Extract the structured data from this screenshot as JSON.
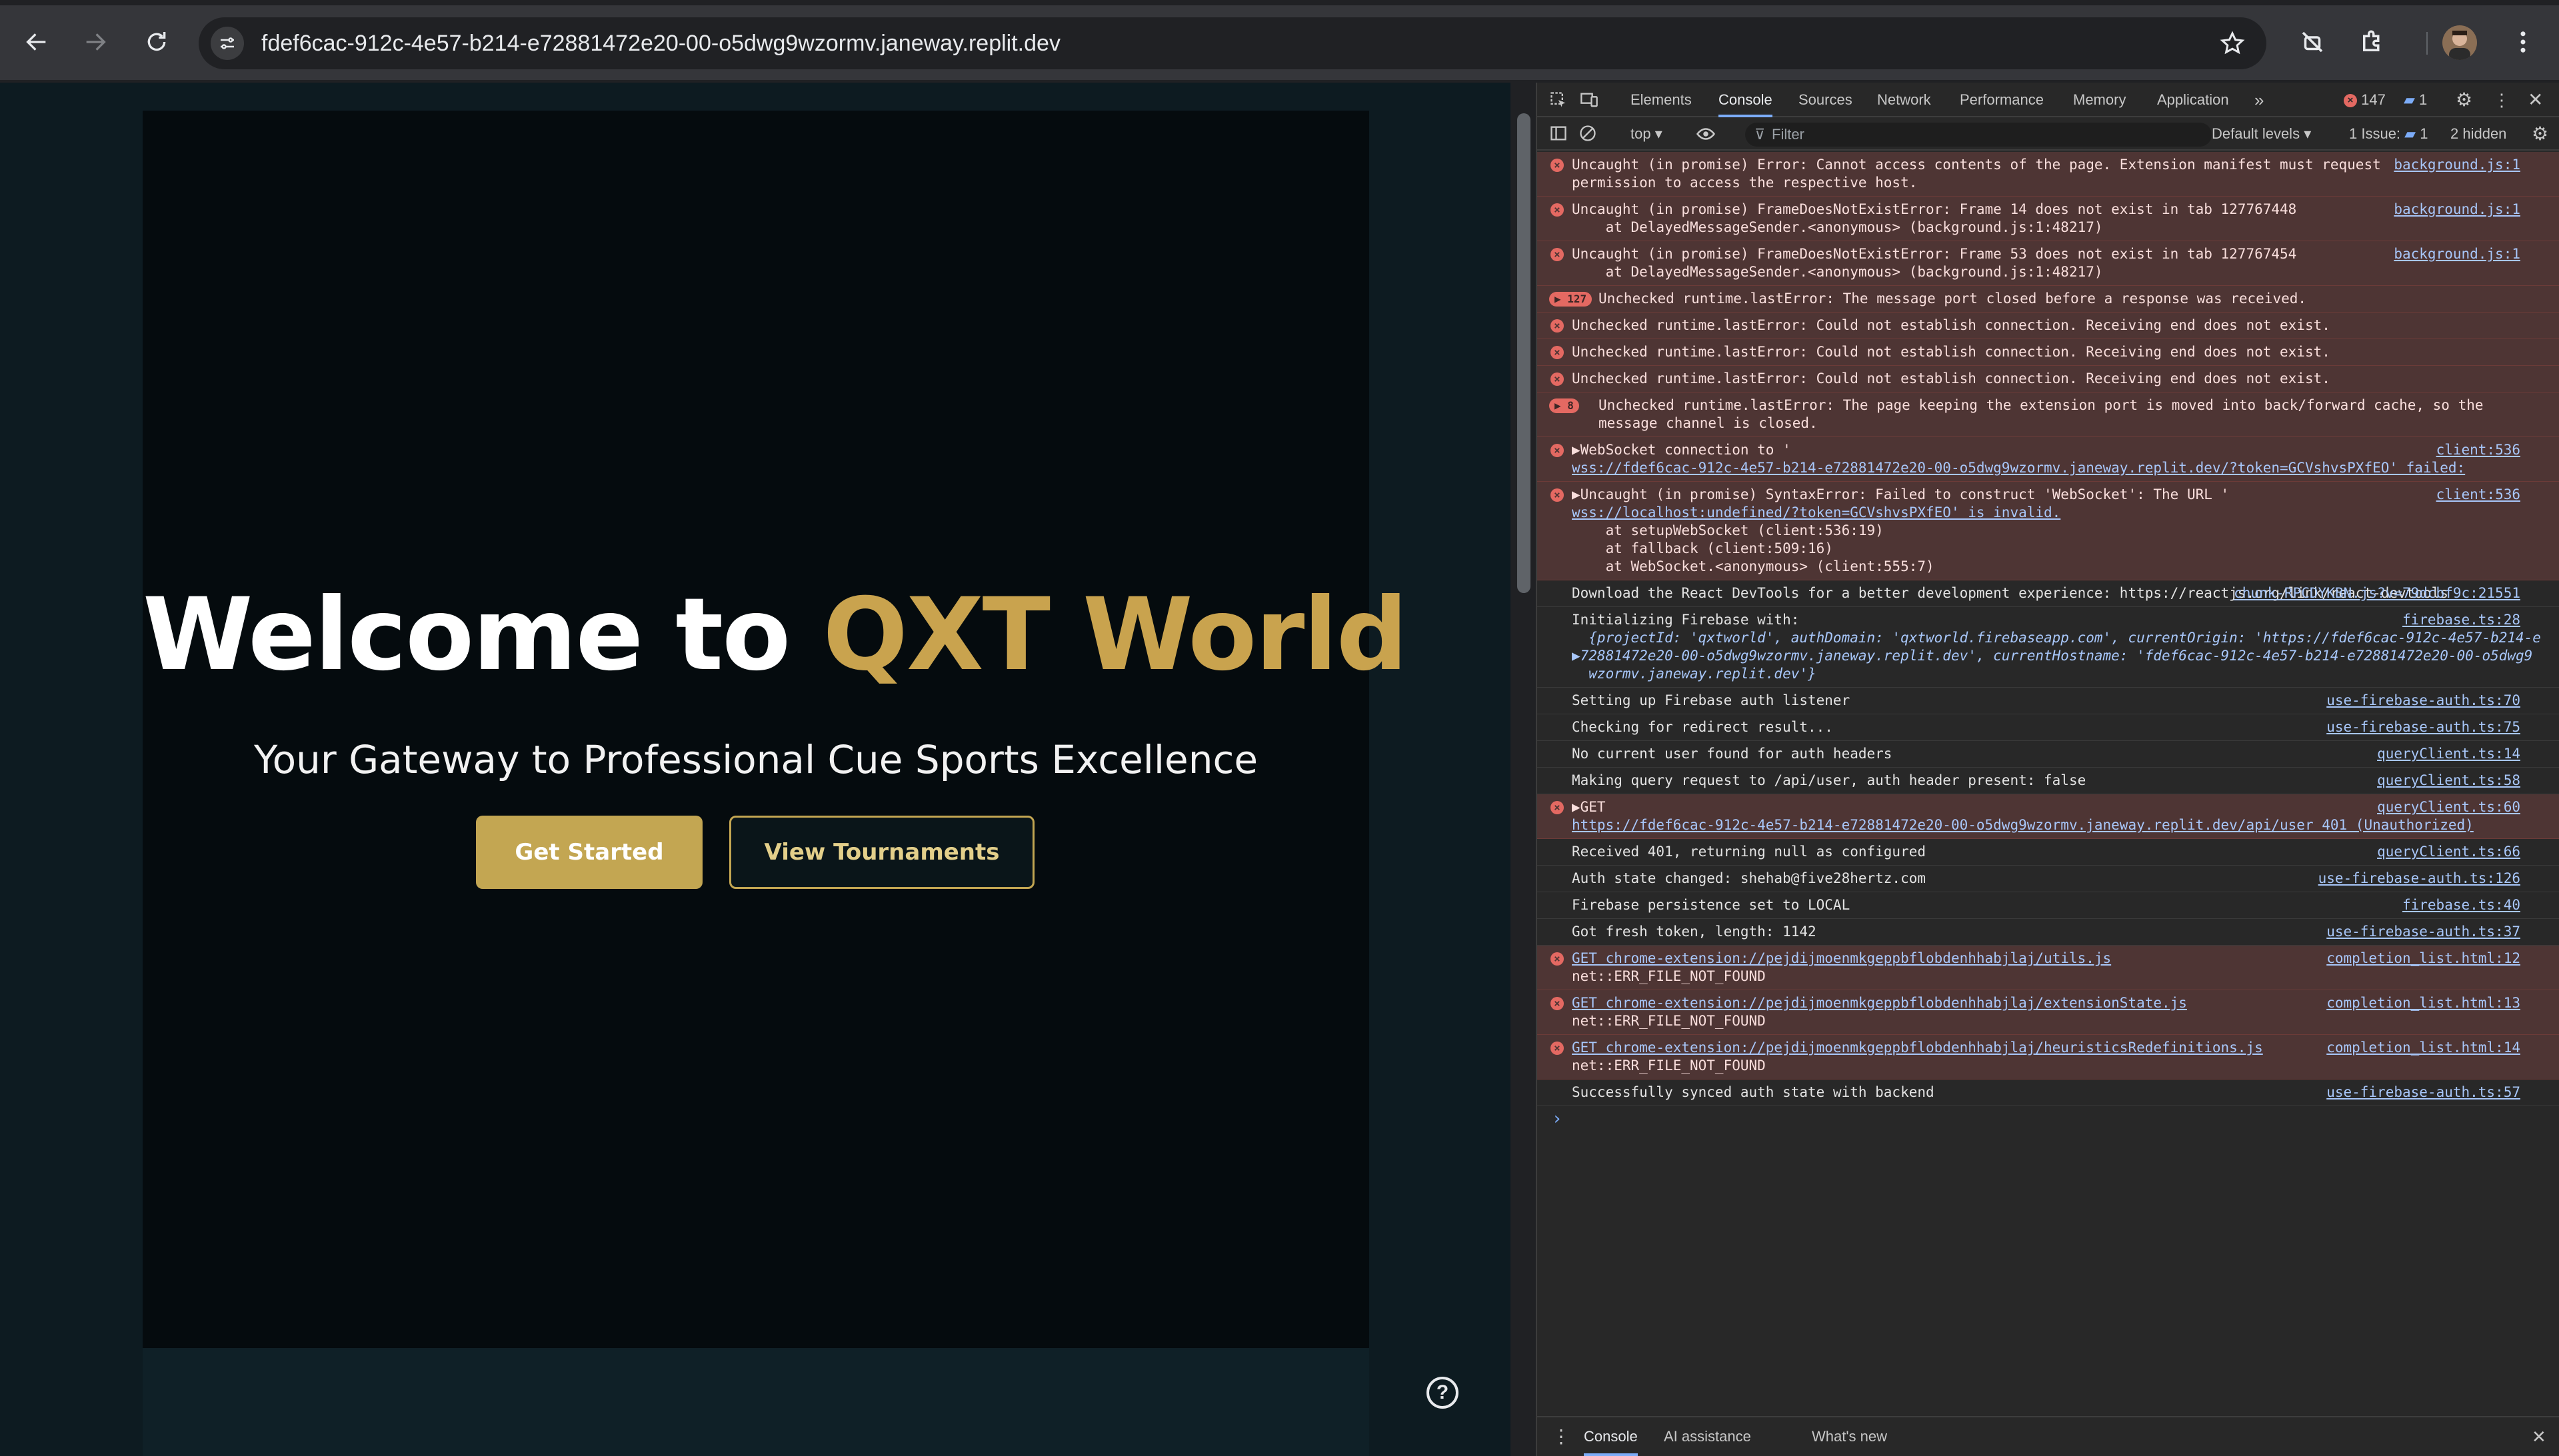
{
  "browser": {
    "url": "fdef6cac-912c-4e57-b214-e72881472e20-00-o5dwg9wzormv.janeway.replit.dev"
  },
  "page": {
    "title_main": "Welcome to ",
    "title_accent": "QXT World",
    "subtitle": "Your Gateway to Professional Cue Sports Excellence",
    "primary_button": "Get Started",
    "secondary_button": "View Tournaments",
    "help_glyph": "?",
    "colors": {
      "accent": "#c9a34e",
      "background": "#050b0e"
    }
  },
  "devtools": {
    "tabs": [
      "Elements",
      "Console",
      "Sources",
      "Network",
      "Performance",
      "Memory",
      "Application"
    ],
    "active_tab": "Console",
    "error_count": "147",
    "message_count": "1",
    "context": "top",
    "filter_placeholder": "Filter",
    "levels": "Default levels",
    "issues_label": "1 Issue:",
    "issues_count": "1",
    "hidden": "2 hidden",
    "drawer_tabs": [
      "Console",
      "AI assistance",
      "What's new"
    ],
    "messages": [
      {
        "type": "error",
        "lines": [
          "Uncaught (in promise) Error: Cannot access contents of the page. Extension manifest must request",
          "permission to access the respective host."
        ],
        "source": "background.js:1"
      },
      {
        "type": "error",
        "lines": [
          "Uncaught (in promise) FrameDoesNotExistError: Frame 14 does not exist in tab 127767448",
          "    at DelayedMessageSender.<anonymous> (background.js:1:48217)"
        ],
        "source": "background.js:1"
      },
      {
        "type": "error",
        "lines": [
          "Uncaught (in promise) FrameDoesNotExistError: Frame 53 does not exist in tab 127767454",
          "    at DelayedMessageSender.<anonymous> (background.js:1:48217)"
        ],
        "source": "background.js:1"
      },
      {
        "type": "error",
        "count": "127",
        "lines": [
          "Unchecked runtime.lastError: The message port closed before a response was received."
        ],
        "source": ""
      },
      {
        "type": "error",
        "lines": [
          "Unchecked runtime.lastError: Could not establish connection. Receiving end does not exist."
        ],
        "source": ""
      },
      {
        "type": "error",
        "lines": [
          "Unchecked runtime.lastError: Could not establish connection. Receiving end does not exist."
        ],
        "source": ""
      },
      {
        "type": "error",
        "lines": [
          "Unchecked runtime.lastError: Could not establish connection. Receiving end does not exist."
        ],
        "source": ""
      },
      {
        "type": "error",
        "count": "8",
        "lines": [
          "Unchecked runtime.lastError: The page keeping the extension port is moved into back/forward cache, so the",
          "message channel is closed."
        ],
        "source": ""
      },
      {
        "type": "error",
        "lines": [
          "▶WebSocket connection to '",
          "wss://fdef6cac-912c-4e57-b214-e72881472e20-00-o5dwg9wzormv.janeway.replit.dev/?token=GCVshvsPXfEO' failed:"
        ],
        "source": "client:536"
      },
      {
        "type": "error",
        "lines": [
          "▶Uncaught (in promise) SyntaxError: Failed to construct 'WebSocket': The URL '",
          "wss://localhost:undefined/?token=GCVshvsPXfEO' is invalid.",
          "    at setupWebSocket (client:536:19)",
          "    at fallback (client:509:16)",
          "    at WebSocket.<anonymous> (client:555:7)"
        ],
        "source": "client:536"
      },
      {
        "type": "log",
        "lines": [
          "",
          "Download the React DevTools for a better development experience: https://reactjs.org/link/react-devtools"
        ],
        "source": "chunk-RPCDYKBN.js?v=79dcbf9c:21551"
      },
      {
        "type": "log",
        "lines": [
          "Initializing Firebase with:",
          "  {projectId: 'qxtworld', authDomain: 'qxtworld.firebaseapp.com', currentOrigin: 'https://fdef6cac-912c-4e57-b214-e",
          "▶72881472e20-00-o5dwg9wzormv.janeway.replit.dev', currentHostname: 'fdef6cac-912c-4e57-b214-e72881472e20-00-o5dwg9",
          "  wzormv.janeway.replit.dev'}"
        ],
        "source": "firebase.ts:28"
      },
      {
        "type": "log",
        "lines": [
          "Setting up Firebase auth listener"
        ],
        "source": "use-firebase-auth.ts:70"
      },
      {
        "type": "log",
        "lines": [
          "Checking for redirect result..."
        ],
        "source": "use-firebase-auth.ts:75"
      },
      {
        "type": "log",
        "lines": [
          "No current user found for auth headers"
        ],
        "source": "queryClient.ts:14"
      },
      {
        "type": "log",
        "lines": [
          "Making query request to /api/user, auth header present: false"
        ],
        "source": "queryClient.ts:58"
      },
      {
        "type": "error",
        "lines": [
          "▶GET",
          "https://fdef6cac-912c-4e57-b214-e72881472e20-00-o5dwg9wzormv.janeway.replit.dev/api/user 401 (Unauthorized)"
        ],
        "source": "queryClient.ts:60"
      },
      {
        "type": "log",
        "lines": [
          "Received 401, returning null as configured"
        ],
        "source": "queryClient.ts:66"
      },
      {
        "type": "log",
        "lines": [
          "Auth state changed: shehab@five28hertz.com"
        ],
        "source": "use-firebase-auth.ts:126"
      },
      {
        "type": "log",
        "lines": [
          "Firebase persistence set to LOCAL"
        ],
        "source": "firebase.ts:40"
      },
      {
        "type": "log",
        "lines": [
          "Got fresh token, length: 1142"
        ],
        "source": "use-firebase-auth.ts:37"
      },
      {
        "type": "error",
        "lines": [
          "GET chrome-extension://pejdijmoenmkgeppbflobdenhhabjlaj/utils.js",
          "net::ERR_FILE_NOT_FOUND"
        ],
        "source": "completion_list.html:12"
      },
      {
        "type": "error",
        "lines": [
          "GET chrome-extension://pejdijmoenmkgeppbflobdenhhabjlaj/extensionState.js",
          "net::ERR_FILE_NOT_FOUND"
        ],
        "source": "completion_list.html:13"
      },
      {
        "type": "error",
        "lines": [
          "GET chrome-extension://pejdijmoenmkgeppbflobdenhhabjlaj/heuristicsRedefinitions.js",
          "net::ERR_FILE_NOT_FOUND"
        ],
        "source": "completion_list.html:14"
      },
      {
        "type": "log",
        "lines": [
          "Successfully synced auth state with backend"
        ],
        "source": "use-firebase-auth.ts:57"
      }
    ],
    "prompt": "›"
  }
}
